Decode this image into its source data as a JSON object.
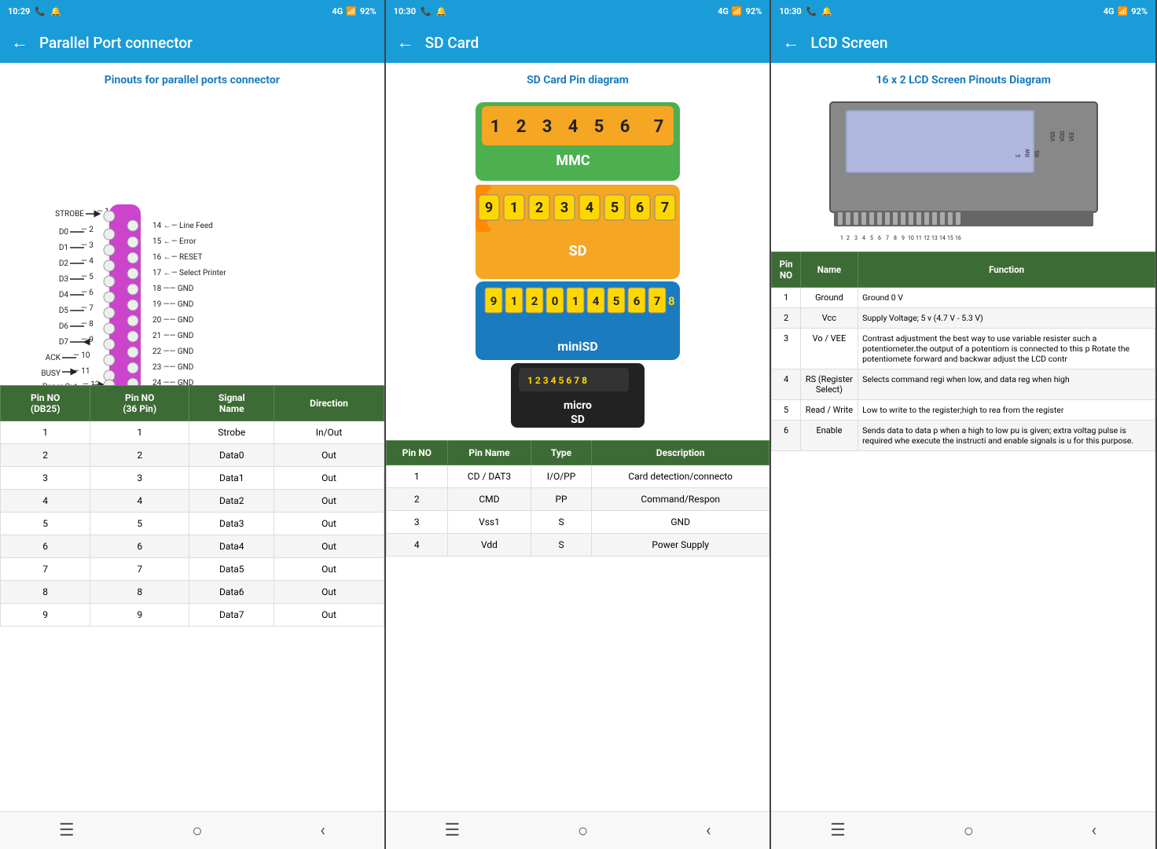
{
  "panel1": {
    "status": {
      "time": "10:29",
      "signal1": "4G",
      "signal2": "92%",
      "battery": "92%"
    },
    "title": "Parallel Port connector",
    "section_title": "Pinouts for parallel ports connector",
    "table": {
      "headers": [
        "Pin NO\n(DB25)",
        "Pin NO\n(36 Pin)",
        "Signal\nName",
        "Direction"
      ],
      "rows": [
        [
          "1",
          "1",
          "Strobe",
          "In/Out"
        ],
        [
          "2",
          "2",
          "Data0",
          "Out"
        ],
        [
          "3",
          "3",
          "Data1",
          "Out"
        ],
        [
          "4",
          "4",
          "Data2",
          "Out"
        ],
        [
          "5",
          "5",
          "Data3",
          "Out"
        ],
        [
          "6",
          "6",
          "Data4",
          "Out"
        ],
        [
          "7",
          "7",
          "Data5",
          "Out"
        ],
        [
          "8",
          "8",
          "Data6",
          "Out"
        ],
        [
          "9",
          "9",
          "Data7",
          "Out"
        ]
      ]
    }
  },
  "panel2": {
    "status": {
      "time": "10:30",
      "signal": "92%"
    },
    "title": "SD Card",
    "section_title": "SD Card Pin diagram",
    "table": {
      "headers": [
        "Pin NO",
        "Pin Name",
        "Type",
        "Description"
      ],
      "rows": [
        [
          "1",
          "CD / DAT3",
          "I/O/PP",
          "Card detection/connecto"
        ],
        [
          "2",
          "CMD",
          "PP",
          "Command/Respon"
        ],
        [
          "3",
          "Vss1",
          "S",
          "GND"
        ],
        [
          "4",
          "Vdd",
          "S",
          "Power Supply"
        ]
      ]
    }
  },
  "panel3": {
    "status": {
      "time": "10:30",
      "signal": "92%"
    },
    "title": "LCD Screen",
    "section_title": "16 x 2 LCD Screen Pinouts Diagram",
    "table": {
      "headers": [
        "Pin NO",
        "Name",
        "Function"
      ],
      "rows": [
        [
          "1",
          "Ground",
          "Ground 0 V"
        ],
        [
          "2",
          "Vcc",
          "Supply Voltage; 5 v\n(4.7 V - 5.3 V)"
        ],
        [
          "3",
          "Vo / VEE",
          "Contrast adjustment\nthe best way to use\nvariable resister such\na potentiometer.the\noutput of a potentiom\nis connected to this p\nRotate the potentiomete\nforward and backwar\nadjust the LCD contr"
        ],
        [
          "4",
          "RS (Register Select)",
          "Selects command regi\nwhen low, and data reg\nwhen high"
        ],
        [
          "5",
          "Read / Write",
          "Low to write to the\nregister;high to rea\nfrom the register"
        ],
        [
          "6",
          "Enable",
          "Sends data to data p\nwhen a high to low pu\nis given; extra voltag\npulse is required whe\nexecute the instructi\nand enable signals is u\nfor this purpose."
        ]
      ]
    }
  }
}
